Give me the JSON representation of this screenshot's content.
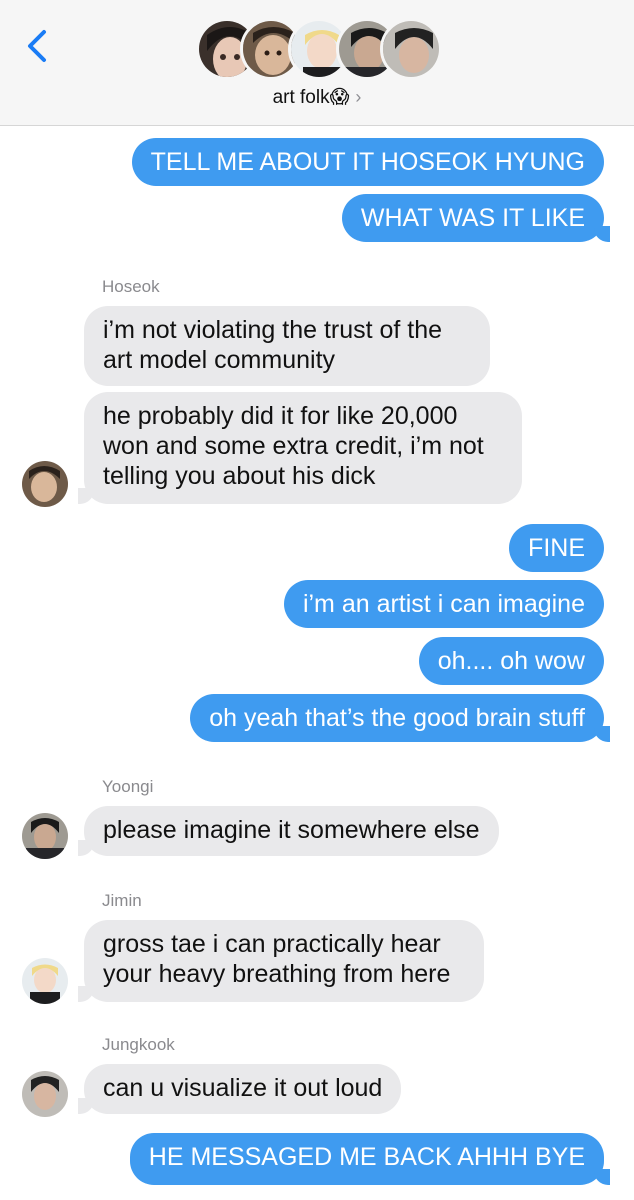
{
  "header": {
    "group_name": "art folk",
    "group_emoji": "😱",
    "chevron": "›",
    "back_icon": "chevron-left-icon",
    "members": [
      "Taehyung",
      "Hoseok",
      "Jimin",
      "Yoongi",
      "Jungkook"
    ]
  },
  "colors": {
    "outgoing": "#3f9bf0",
    "incoming": "#e9e9eb",
    "header_bg": "#f6f6f6",
    "accent": "#1a7cf5"
  },
  "messages": [
    {
      "dir": "out",
      "text": "TELL ME ABOUT IT HOSEOK HYUNG"
    },
    {
      "dir": "out",
      "text": "WHAT WAS IT LIKE"
    },
    {
      "dir": "in",
      "sender": "Hoseok",
      "text": "i’m not violating the trust of the art model community"
    },
    {
      "dir": "in",
      "sender": "Hoseok",
      "text": "he probably did it for like 20,000 won and some extra credit, i’m not telling you about his dick"
    },
    {
      "dir": "out",
      "text": "FINE"
    },
    {
      "dir": "out",
      "text": "i’m an artist i can imagine"
    },
    {
      "dir": "out",
      "text": "oh.... oh wow"
    },
    {
      "dir": "out",
      "text": "oh yeah that’s the good brain stuff"
    },
    {
      "dir": "in",
      "sender": "Yoongi",
      "text": "please imagine it somewhere else"
    },
    {
      "dir": "in",
      "sender": "Jimin",
      "text": "gross tae i can practically hear your heavy breathing from here"
    },
    {
      "dir": "in",
      "sender": "Jungkook",
      "text": "can u visualize it out loud"
    },
    {
      "dir": "out",
      "text": "HE MESSAGED ME BACK AHHH BYE"
    }
  ],
  "bubble_lines": {
    "m3": [
      "i’m not violating the trust of the",
      "art model community"
    ],
    "m4": [
      "he probably did it for like 20,000",
      "won and some extra credit, i’m not",
      "telling you about his dick"
    ],
    "m10": [
      "gross tae i can practically hear",
      "your heavy breathing from here"
    ]
  }
}
